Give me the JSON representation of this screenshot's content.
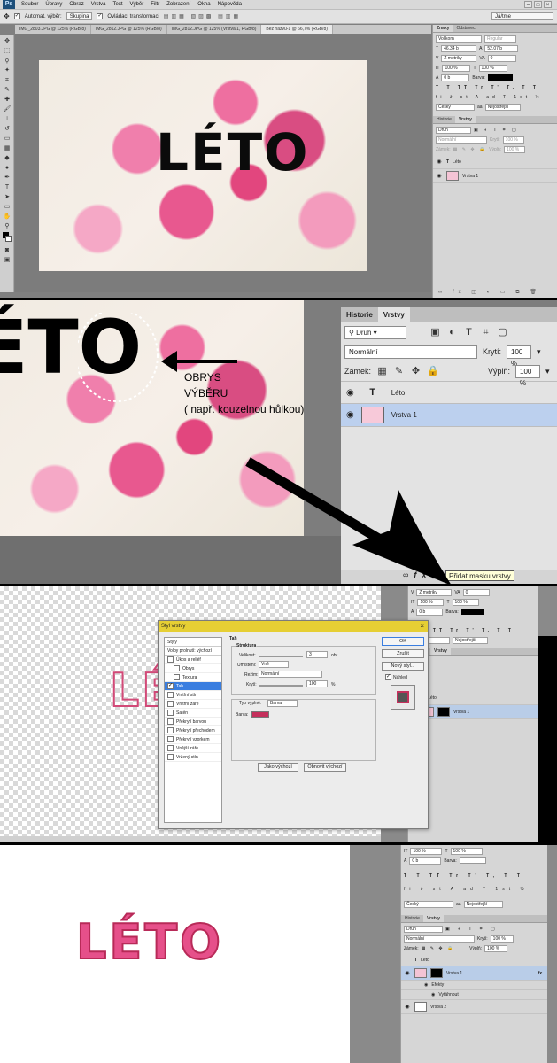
{
  "menu": {
    "app_logo": "Ps",
    "items": [
      "Soubor",
      "Úpravy",
      "Obraz",
      "Vrstva",
      "Text",
      "Výběr",
      "Filtr",
      "Zobrazení",
      "Okna",
      "Nápověda"
    ]
  },
  "options_bar": {
    "auto_select_label": "Automat. výběr:",
    "auto_select_value": "Skupina",
    "transform_label": "Ovládací transformaci",
    "workspace": "Já/tme"
  },
  "doc_tabs": [
    "IMG_2803.JPG @ 125% (RGB/8)",
    "IMG_2812.JPG @ 125% (RGB/8)",
    "IMG_2812.JPG @ 125% (Vrstva 1, RGB/8)",
    "Bez názvu-1 @ 66,7% (RGB/8)"
  ],
  "canvas_text": "LÉTO",
  "character_panel": {
    "tabs": [
      "Znaky",
      "Odstavec"
    ],
    "font": "Vollkorn",
    "style": "Regular",
    "size": "46,34 b",
    "leading": "52,07 b",
    "tracking": "Z metriky",
    "kerning": "0",
    "scale_v": "100 %",
    "scale_h": "100 %",
    "baseline": "0 b",
    "color_label": "Barva:",
    "language": "Český",
    "antialias": "Nejostřejší"
  },
  "layers_panel": {
    "tabs": [
      "Historie",
      "Vrstvy"
    ],
    "filter_kind": "Druh",
    "blend_mode": "Normální",
    "opacity_label": "Krytí:",
    "opacity_value": "100 %",
    "lock_label": "Zámek:",
    "fill_label": "Výplň:",
    "fill_value": "100 %",
    "layers": [
      "Léto",
      "Vrstva 1"
    ],
    "tooltip": "Přidat masku vrstvy"
  },
  "annotation": {
    "line1": "OBRYS",
    "line2": "VÝBĚRU",
    "line3": "( např. kouzelnou hůlkou)"
  },
  "layer_style_dialog": {
    "title": "Styl vrstvy",
    "styles_header": "Styly",
    "blend_options": "Volby prolnutí: výchozí",
    "effects": [
      {
        "label": "Úkos a reliéf",
        "checked": false
      },
      {
        "label": "Obrys",
        "checked": false
      },
      {
        "label": "Textura",
        "checked": false
      },
      {
        "label": "Tah",
        "checked": true,
        "selected": true
      },
      {
        "label": "Vnitřní stín",
        "checked": false
      },
      {
        "label": "Vnitřní záře",
        "checked": false
      },
      {
        "label": "Satén",
        "checked": false
      },
      {
        "label": "Překrytí barvou",
        "checked": false
      },
      {
        "label": "Překrytí přechodem",
        "checked": false
      },
      {
        "label": "Překrytí vzorkem",
        "checked": false
      },
      {
        "label": "Vnější záře",
        "checked": false
      },
      {
        "label": "Vržený stín",
        "checked": false
      }
    ],
    "section_title": "Tah",
    "structure_title": "Struktura",
    "size_label": "Velikost:",
    "size_value": "3",
    "size_unit": "obr.",
    "position_label": "Umístění:",
    "position_value": "Vně",
    "mode_label": "Režim:",
    "mode_value": "Normální",
    "opacity_label": "Krytí:",
    "opacity_value": "100",
    "opacity_unit": "%",
    "fill_type_label": "Typ výplně:",
    "fill_type_value": "Barva",
    "color_label": "Barva:",
    "stroke_color": "#c4305c",
    "default_btn": "Jako výchozí",
    "reset_btn": "Obnovit výchozí",
    "ok": "OK",
    "cancel": "Zrušit",
    "new_style": "Nový styl...",
    "preview_label": "Náhled"
  },
  "final_panel": {
    "layers": [
      {
        "name": "Léto"
      },
      {
        "name": "Vrstva 1",
        "fx": "fx"
      },
      {
        "name": "Efekty"
      },
      {
        "name": "Vytáhnout"
      },
      {
        "name": "Vrstva 2"
      }
    ]
  }
}
